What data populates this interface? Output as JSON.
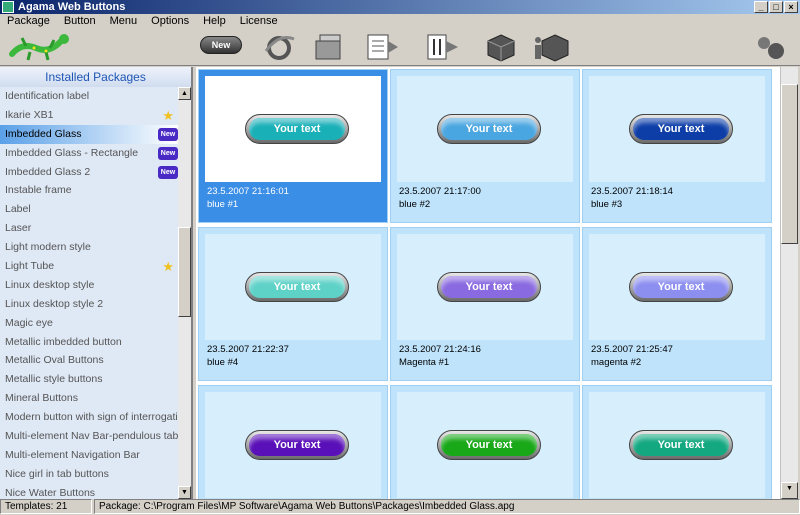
{
  "window": {
    "title": "Agama Web Buttons"
  },
  "menu": [
    "Package",
    "Button",
    "Menu",
    "Options",
    "Help",
    "License"
  ],
  "toolbar": {
    "new_label": "New"
  },
  "sidebar": {
    "title": "Installed Packages",
    "items": [
      {
        "label": "Identification label"
      },
      {
        "label": "Ikarie XB1",
        "badge": "star"
      },
      {
        "label": "Imbedded Glass",
        "badge": "new",
        "selected": true
      },
      {
        "label": "Imbedded Glass - Rectangle",
        "badge": "new"
      },
      {
        "label": "Imbedded Glass 2",
        "badge": "new"
      },
      {
        "label": "Instable frame"
      },
      {
        "label": "Label"
      },
      {
        "label": "Laser"
      },
      {
        "label": "Light modern style"
      },
      {
        "label": "Light Tube",
        "badge": "star"
      },
      {
        "label": "Linux desktop style"
      },
      {
        "label": "Linux desktop style 2"
      },
      {
        "label": "Magic eye"
      },
      {
        "label": "Metallic imbedded button"
      },
      {
        "label": "Metallic Oval Buttons"
      },
      {
        "label": "Metallic style buttons"
      },
      {
        "label": "Mineral Buttons"
      },
      {
        "label": "Modern button with sign of interrogation"
      },
      {
        "label": "Multi-element Nav Bar-pendulous tab"
      },
      {
        "label": "Multi-element Navigation Bar"
      },
      {
        "label": "Nice girl in tab buttons"
      },
      {
        "label": "Nice Water Buttons"
      }
    ]
  },
  "badges": {
    "new": "New"
  },
  "gallery": {
    "button_text": "Your text",
    "tiles": [
      {
        "date": "23.5.2007 21:16:01",
        "name": "blue #1",
        "color": "#1ab0b8",
        "selected": true
      },
      {
        "date": "23.5.2007 21:17:00",
        "name": "blue #2",
        "color": "#4aa6e0"
      },
      {
        "date": "23.5.2007 21:18:14",
        "name": "blue #3",
        "color": "#0d3ea8"
      },
      {
        "date": "23.5.2007 21:22:37",
        "name": "blue #4",
        "color": "#5fd2c8"
      },
      {
        "date": "23.5.2007 21:24:16",
        "name": "Magenta #1",
        "color": "#8a6ae0"
      },
      {
        "date": "23.5.2007 21:25:47",
        "name": "magenta #2",
        "color": "#8c8ef0"
      },
      {
        "date": "",
        "name": "",
        "color": "#5a10b8"
      },
      {
        "date": "",
        "name": "",
        "color": "#18a818"
      },
      {
        "date": "",
        "name": "",
        "color": "#14a880"
      }
    ]
  },
  "status": {
    "templates": "Templates: 21",
    "package": "Package: C:\\Program Files\\MP Software\\Agama Web Buttons\\Packages\\Imbedded Glass.apg"
  }
}
